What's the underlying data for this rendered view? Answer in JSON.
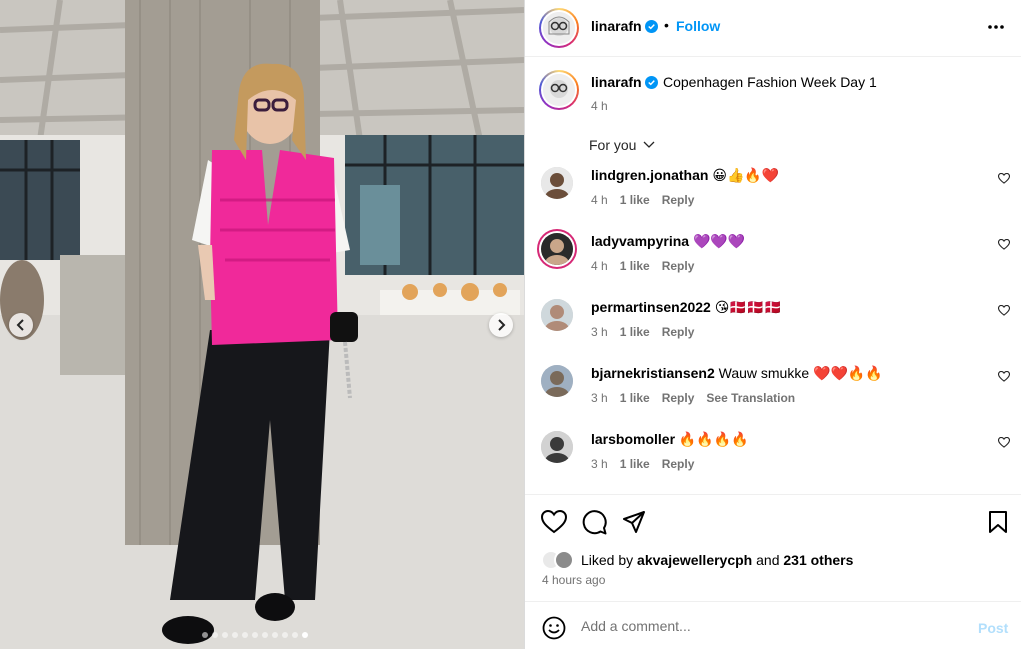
{
  "post": {
    "author": "linarafn",
    "follow_label": "Follow",
    "separator": "•",
    "caption": "Copenhagen Fashion Week Day 1",
    "caption_time": "4 h",
    "sort_label": "For you",
    "comments": [
      {
        "user": "lindgren.jonathan",
        "text": "😀👍🔥❤️",
        "time": "4 h",
        "likes": "1 like",
        "reply": "Reply",
        "translate": ""
      },
      {
        "user": "ladyvampyrina",
        "text": "💜💜💜",
        "time": "4 h",
        "likes": "1 like",
        "reply": "Reply",
        "translate": ""
      },
      {
        "user": "permartinsen2022",
        "text": "😘🇩🇰🇩🇰🇩🇰",
        "time": "3 h",
        "likes": "1 like",
        "reply": "Reply",
        "translate": ""
      },
      {
        "user": "bjarnekristiansen2",
        "text": "Wauw smukke ❤️❤️🔥🔥",
        "time": "3 h",
        "likes": "1 like",
        "reply": "Reply",
        "translate": "See Translation"
      },
      {
        "user": "larsbomoller",
        "text": "🔥🔥🔥🔥",
        "time": "3 h",
        "likes": "1 like",
        "reply": "Reply",
        "translate": ""
      }
    ],
    "liked_by_prefix": "Liked by",
    "liked_by_user": "akvajewellerycph",
    "liked_by_and": "and",
    "liked_by_others": "231 others",
    "posted_ago": "4 hours ago",
    "comment_placeholder": "Add a comment...",
    "post_label": "Post"
  },
  "carousel": {
    "total_slides": 11,
    "active_slide": 10
  },
  "colors": {
    "accent": "#0095f6",
    "post_disabled": "#b2dffc",
    "muted": "#737373",
    "vest": "#f0299a"
  },
  "icons": {
    "header_more": "more-horizontal-icon",
    "verified": "verified-badge-icon",
    "like": "heart-icon",
    "comment": "comment-bubble-icon",
    "share": "paper-plane-icon",
    "save": "bookmark-icon",
    "emoji": "smiley-icon",
    "prev": "chevron-left-icon",
    "next": "chevron-right-icon",
    "sort": "chevron-down-icon"
  }
}
